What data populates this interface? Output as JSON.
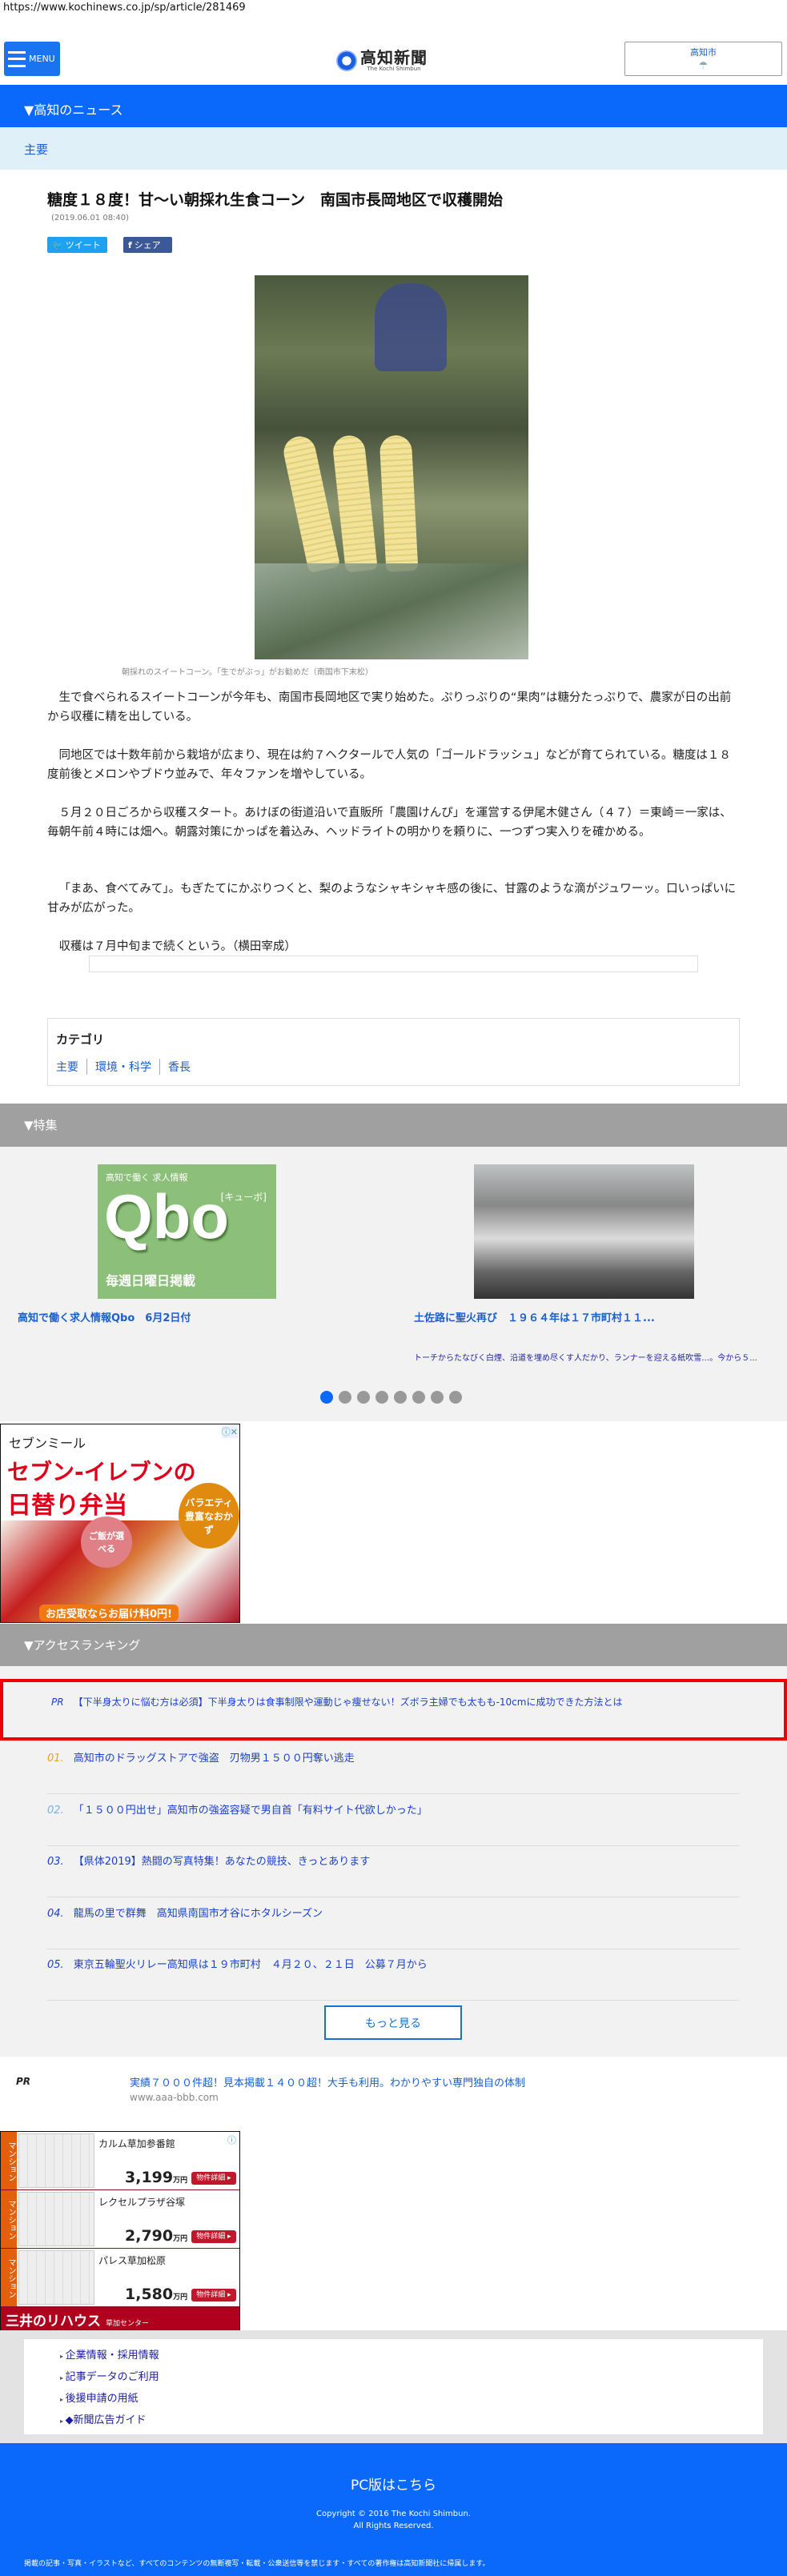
{
  "url": "https://www.kochinews.co.jp/sp/article/281469",
  "header": {
    "menu_label": "MENU",
    "logo_text": "高知新聞",
    "logo_sub": "The Kochi Shimbun",
    "weather_city": "高知市",
    "weather_icon": "umbrella-icon"
  },
  "nav": {
    "section": "▼高知のニュース",
    "subsection": "主要"
  },
  "article": {
    "title": "糖度１８度！甘～い朝採れ生食コーン　南国市長岡地区で収穫開始",
    "date": "(2019.06.01 08:40)",
    "tweet_label": "ツイート",
    "share_label": "シェア",
    "photo_caption": "朝採れのスイートコーン。「生でがぶっ」がお勧めだ（南国市下末松）",
    "paragraphs": [
      "生で食べられるスイートコーンが今年も、南国市長岡地区で実り始めた。ぷりっぷりの“果肉”は糖分たっぷりで、農家が日の出前から収穫に精を出している。",
      "同地区では十数年前から栽培が広まり、現在は約７ヘクタールで人気の「ゴールドラッシュ」などが育てられている。糖度は１８度前後とメロンやブドウ並みで、年々ファンを増やしている。",
      "５月２０日ごろから収穫スタート。あけぼの街道沿いで直販所「農園けんぴ」を運営する伊尾木健さん（４７）＝東崎＝一家は、毎朝午前４時には畑へ。朝露対策にかっぱを着込み、ヘッドライトの明かりを頼りに、一つずつ実入りを確かめる。",
      "「まあ、食べてみて」。もぎたてにかぶりつくと、梨のようなシャキシャキ感の後に、甘露のような滴がジュワーッ。口いっぱいに甘みが広がった。",
      "収穫は７月中旬まで続くという。（横田宰成）"
    ]
  },
  "category": {
    "heading": "カテゴリ",
    "links": [
      "主要",
      "環境・科学",
      "香長"
    ]
  },
  "features": {
    "heading": "▼特集",
    "items": [
      {
        "title": "高知で働く求人情報Qbo　6月2日付",
        "image_top": "高知で働く 求人情報",
        "image_logo": "Qbo",
        "image_kana": "[キューボ]",
        "image_bottom": "毎週日曜日掲載"
      },
      {
        "title": "土佐路に聖火再び　１９６４年は１７市町村１１...",
        "description": "トーチからたなびく白煙、沿道を埋め尽くす人だかり、ランナーを迎える紙吹雪…。今から５..."
      }
    ],
    "dots_total": 8,
    "dots_active": 1
  },
  "ad_seven": {
    "brand": "セブンミール",
    "headline1": "セブン-イレブンの",
    "headline2": "日替り弁当",
    "badge1": "ご飯が選べる",
    "badge2": "バラエティ豊富なおかず",
    "footer": "お店受取ならお届け料0円!"
  },
  "ranking": {
    "heading": "▼アクセスランキング",
    "pr_label": "PR",
    "pr_text": "【下半身太りに悩む方は必須】下半身太りは食事制限や運動じゃ痩せない！ズボラ主婦でも太もも-10cmに成功できた方法とは",
    "items": [
      {
        "num": "01.",
        "title": "高知市のドラッグストアで強盗　刃物男１５００円奪い逃走",
        "color": "#e8a020"
      },
      {
        "num": "02.",
        "title": "「１５００円出せ」高知市の強盗容疑で男自首「有料サイト代欲しかった」",
        "color": "#7ab0e0"
      },
      {
        "num": "03.",
        "title": "【県体2019】熱闘の写真特集！あなたの競技、きっとあります",
        "color": "#1a3fd0"
      },
      {
        "num": "04.",
        "title": "龍馬の里で群舞　高知県南国市才谷にホタルシーズン",
        "color": "#1a3fd0"
      },
      {
        "num": "05.",
        "title": "東京五輪聖火リレー高知県は１９市町村　４月２０、２１日　公募７月から",
        "color": "#1a3fd0"
      }
    ],
    "more_label": "もっと見る"
  },
  "pr_ad": {
    "label": "PR",
    "text": "実績７０００件超！見本掲載１４００超！大手も利用。わかりやすい専門独自の体制",
    "domain": "www.aaa-bbb.com"
  },
  "realestate_ad": {
    "tag": "マンション",
    "detail_label": "物件詳細 ▸",
    "unit": "万円",
    "listings": [
      {
        "name": "カルム草加参番館",
        "price": "3,199"
      },
      {
        "name": "レクセルプラザ谷塚",
        "price": "2,790"
      },
      {
        "name": "パレス草加松原",
        "price": "1,580"
      }
    ],
    "brand": "三井のリハウス",
    "branch": "草加センター"
  },
  "footer_links": [
    "企業情報・採用情報",
    "記事データのご利用",
    "後援申請の用紙",
    "◆新聞広告ガイド"
  ],
  "footer": {
    "pc_link": "PC版はこちら",
    "copyright1": "Copyright © 2016 The Kochi Shimbun.",
    "copyright2": "All Rights Reserved.",
    "notice": "掲載の記事・写真・イラストなど、すべてのコンテンツの無断複写・転載・公衆送信等を禁じます・すべての著作権は高知新聞社に帰属します。"
  },
  "colors": {
    "brand_blue": "#0a68fb",
    "sub_bg": "#dff0f9",
    "section_gray": "#a0a0a0",
    "pr_border": "#ee0000"
  }
}
